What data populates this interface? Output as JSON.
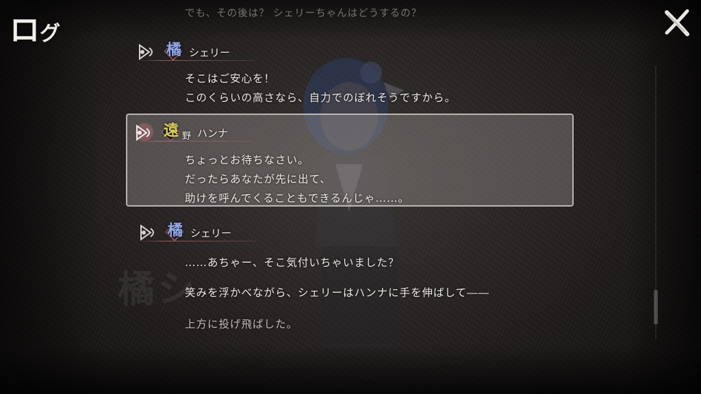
{
  "header": {
    "title_main": "ロ",
    "title_small": "グ"
  },
  "controls": {
    "close_icon": "close-x-icon"
  },
  "previous_line": "でも、その後は？ シェリーちゃんはどうするの？",
  "entries": [
    {
      "speaker_kanji": "橘",
      "speaker_rest": "シェリー",
      "kanji_color": "#8fa8e8",
      "lines": [
        "そこはご安心を！",
        "このくらいの高さなら、自力でのぼれそうですから。"
      ]
    },
    {
      "speaker_kanji": "遠",
      "speaker_kanji2": "野",
      "speaker_rest": "ハンナ",
      "kanji_color": "#d9d25a",
      "lines": [
        "ちょっとお待ちなさい。",
        "だったらあなたが先に出て、",
        "助けを呼んでくることもできるんじゃ……。"
      ]
    },
    {
      "speaker_kanji": "橘",
      "speaker_rest": "シェリー",
      "kanji_color": "#8fa8e8",
      "lines": [
        "……あちゃー、そこ気付いちゃいました？"
      ]
    }
  ],
  "narration": [
    "笑みを浮かべながら、シェリーはハンナに手を伸ばして――",
    "上方に投げ飛ばした。"
  ],
  "watermark_text": "橘シ"
}
